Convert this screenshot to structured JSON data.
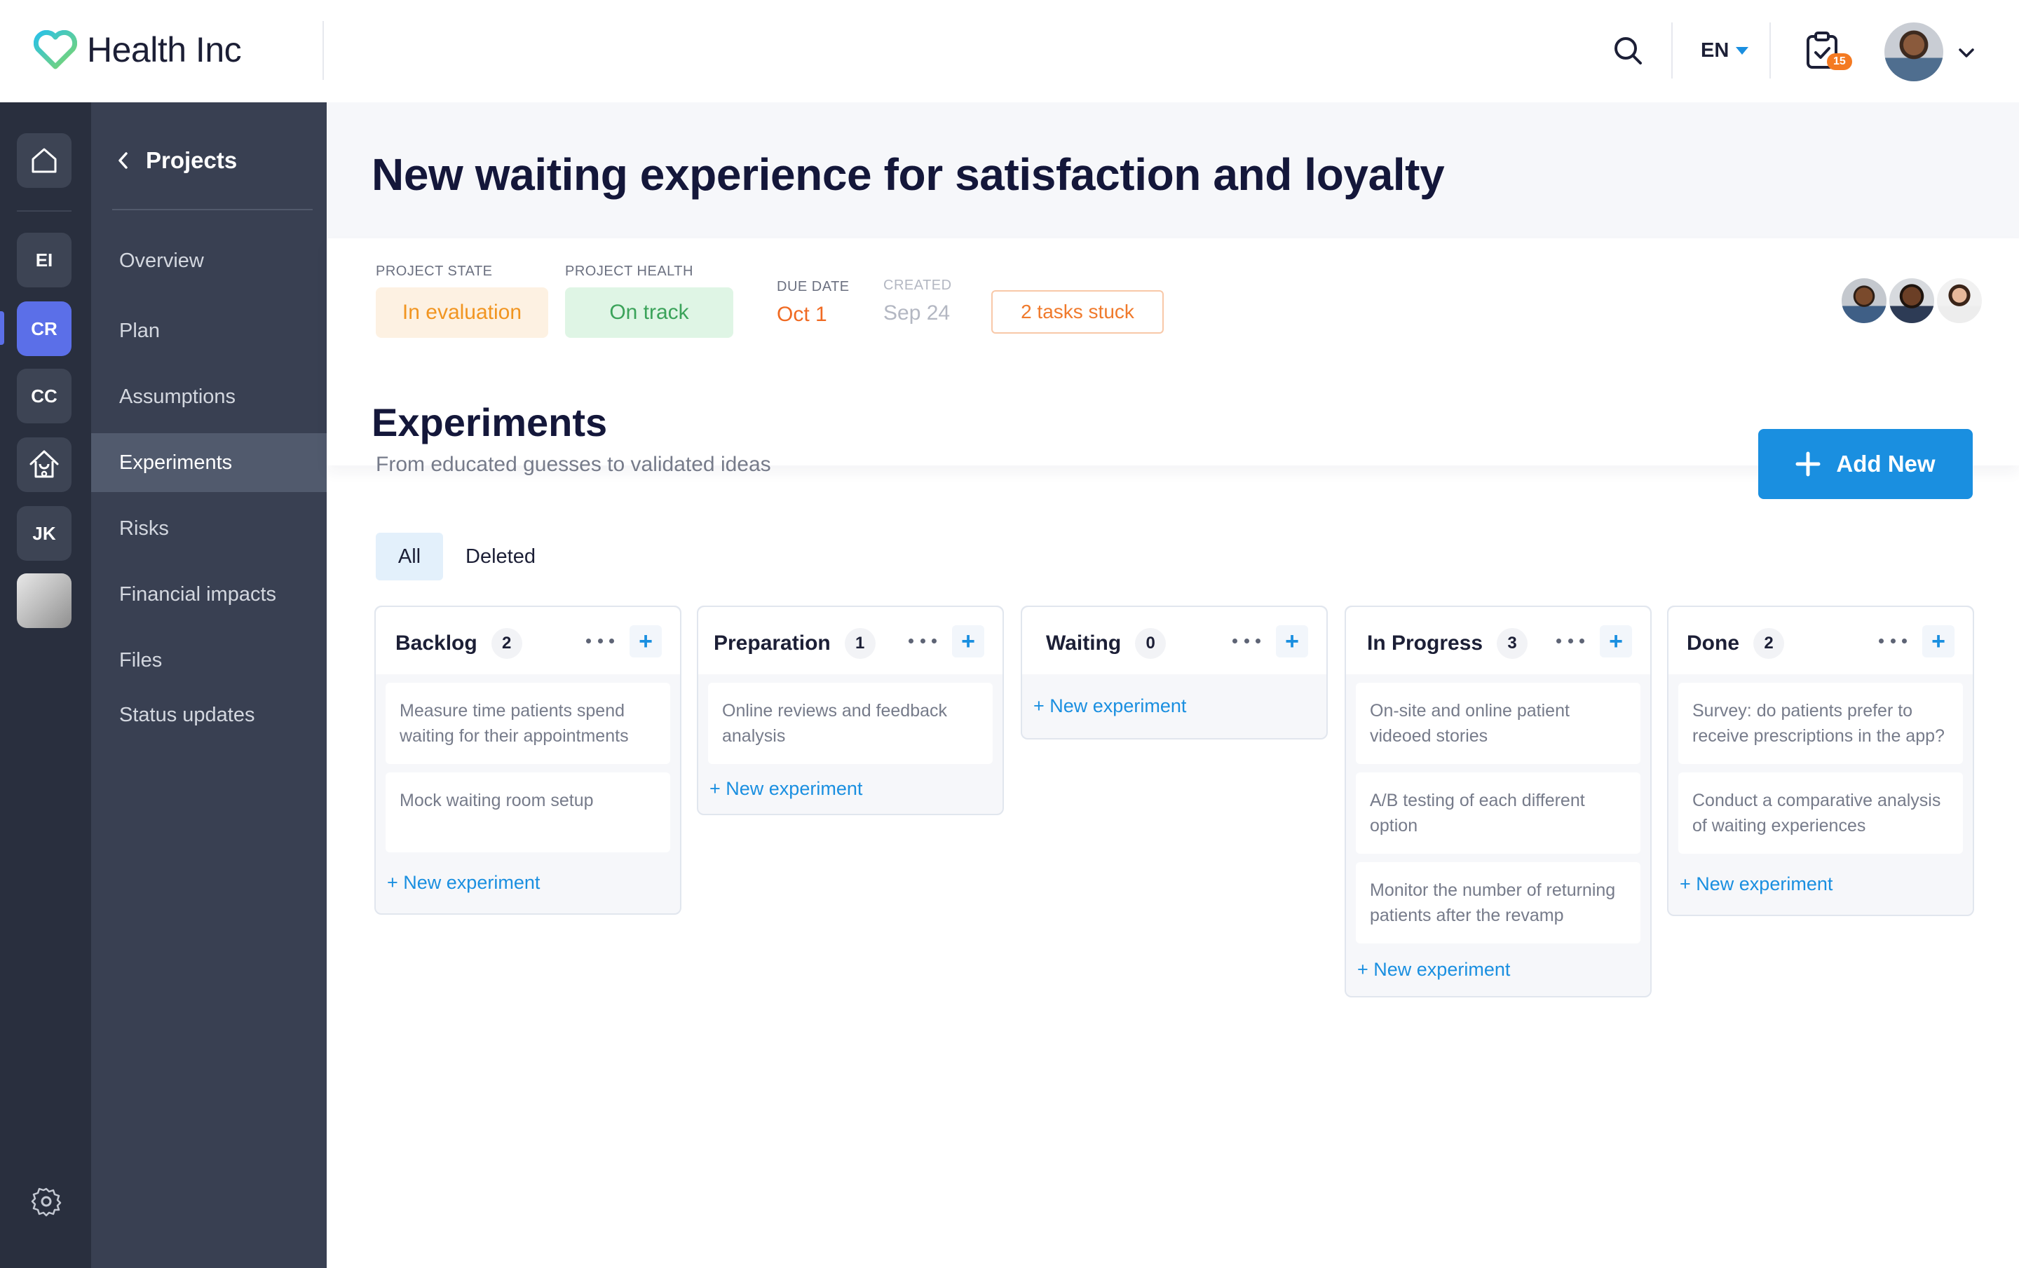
{
  "app": {
    "name": "Health Inc"
  },
  "header": {
    "language": "EN",
    "notifications_count": "15"
  },
  "rail": {
    "items": [
      "EI",
      "CR",
      "CC",
      "JK"
    ]
  },
  "nav": {
    "back_label": "Projects",
    "items": [
      "Overview",
      "Plan",
      "Assumptions",
      "Experiments",
      "Risks",
      "Financial impacts",
      "Files",
      "Status updates"
    ],
    "active": "Experiments"
  },
  "project": {
    "title": "New waiting experience for satisfaction and loyalty",
    "state_label": "PROJECT STATE",
    "state_value": "In evaluation",
    "health_label": "PROJECT HEALTH",
    "health_value": "On track",
    "due_label": "DUE DATE",
    "due_value": "Oct 1",
    "created_label": "CREATED",
    "created_value": "Sep 24",
    "stuck": "2 tasks stuck"
  },
  "experiments": {
    "title": "Experiments",
    "subtitle": "From educated guesses to validated ideas",
    "add_label": "Add New",
    "tabs": [
      "All",
      "Deleted"
    ],
    "new_label": "+ New experiment",
    "columns": [
      {
        "title": "Backlog",
        "count": "2",
        "cards": [
          "Measure time patients spend waiting for their appointments",
          "Mock waiting room setup"
        ]
      },
      {
        "title": "Preparation",
        "count": "1",
        "cards": [
          "Online reviews and feedback analysis"
        ]
      },
      {
        "title": "Waiting",
        "count": "0",
        "cards": []
      },
      {
        "title": "In Progress",
        "count": "3",
        "cards": [
          "On-site and online patient videoed stories",
          "A/B testing of each different option",
          "Monitor the number of returning patients after the revamp"
        ]
      },
      {
        "title": "Done",
        "count": "2",
        "cards": [
          "Survey: do patients prefer to receive prescriptions in the app?",
          "Conduct a comparative analysis of waiting experiences"
        ]
      }
    ]
  },
  "colors": {
    "accent": "#1a8fe0",
    "rail": "#292f3e",
    "nav": "#394052",
    "active_rail": "#5b6fe8"
  }
}
